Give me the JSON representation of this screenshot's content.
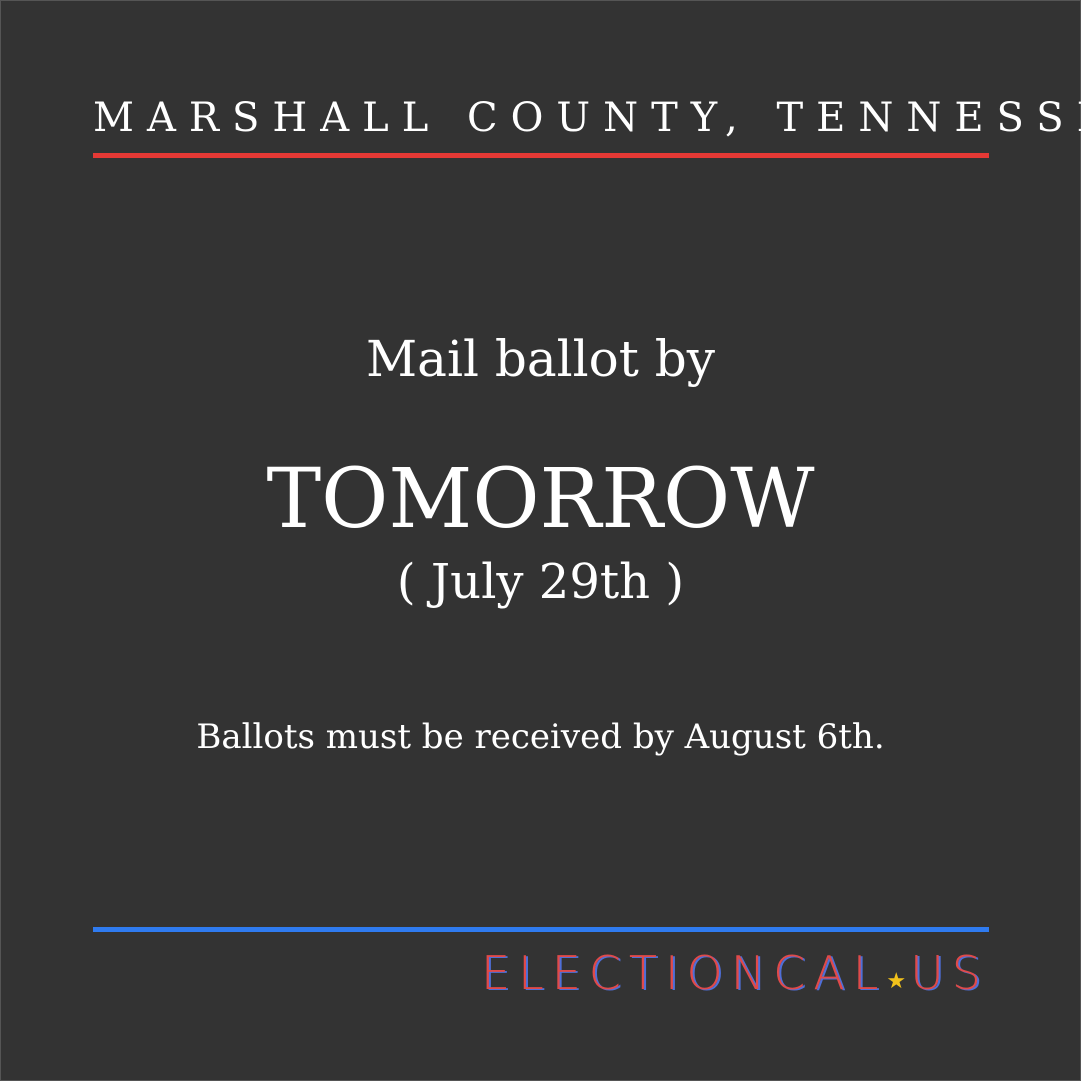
{
  "header": {
    "county": "MARSHALL COUNTY, TENNESSEE"
  },
  "main": {
    "action": "Mail ballot by",
    "deadline": "TOMORROW",
    "date": "( July 29th )",
    "note": "Ballots must be received by August 6th."
  },
  "logo": {
    "part1": "ELECTIONCAL",
    "part2": "US",
    "star_icon": "star-icon"
  },
  "colors": {
    "background": "#333333",
    "top_rule": "#e53935",
    "bottom_rule": "#2f7bf0",
    "logo_red": "#e04a4a",
    "logo_blue": "#4f6fd8",
    "star": "#f2c21b"
  }
}
